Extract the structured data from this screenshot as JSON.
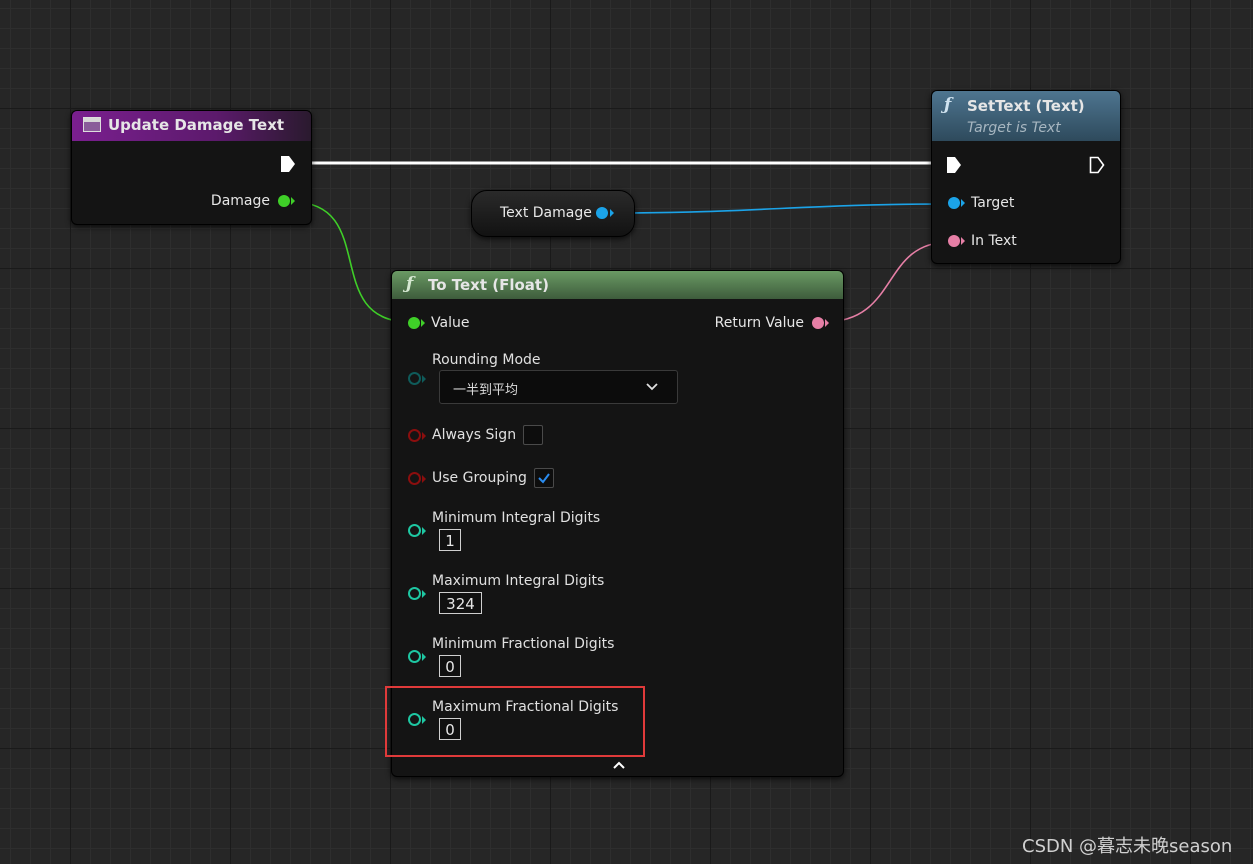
{
  "colors": {
    "exec": "#ffffff",
    "float": "#3fcf28",
    "object": "#1ba3e8",
    "text": "#e67fa6",
    "byte_enum": "#0f5b5a",
    "bool": "#8b0e0e",
    "int": "#1ec7a2",
    "event_header": "#7a1f8f",
    "function_header": "#4e7590",
    "pure_header": "#4a7a4a",
    "highlight": "#e03a3a"
  },
  "event_node": {
    "title": "Update Damage Text",
    "icon": "event-icon",
    "pins": {
      "damage": "Damage"
    }
  },
  "variable_node": {
    "label": "Text Damage"
  },
  "settext_node": {
    "title": "SetText (Text)",
    "subtitle": "Target is Text",
    "icon": "function-icon",
    "pins": {
      "target": "Target",
      "in_text": "In Text"
    }
  },
  "totext_node": {
    "title": "To Text (Float)",
    "icon": "function-icon",
    "pins": {
      "value": "Value",
      "return_value": "Return Value",
      "rounding_mode": "Rounding Mode",
      "always_sign": "Always Sign",
      "use_grouping": "Use Grouping",
      "min_integral": "Minimum Integral Digits",
      "max_integral": "Maximum Integral Digits",
      "min_fractional": "Minimum Fractional Digits",
      "max_fractional": "Maximum Fractional Digits"
    },
    "values": {
      "rounding_mode": "一半到平均",
      "always_sign": false,
      "use_grouping": true,
      "min_integral": "1",
      "max_integral": "324",
      "min_fractional": "0",
      "max_fractional": "0"
    }
  },
  "watermark": "CSDN @暮志未晚season"
}
